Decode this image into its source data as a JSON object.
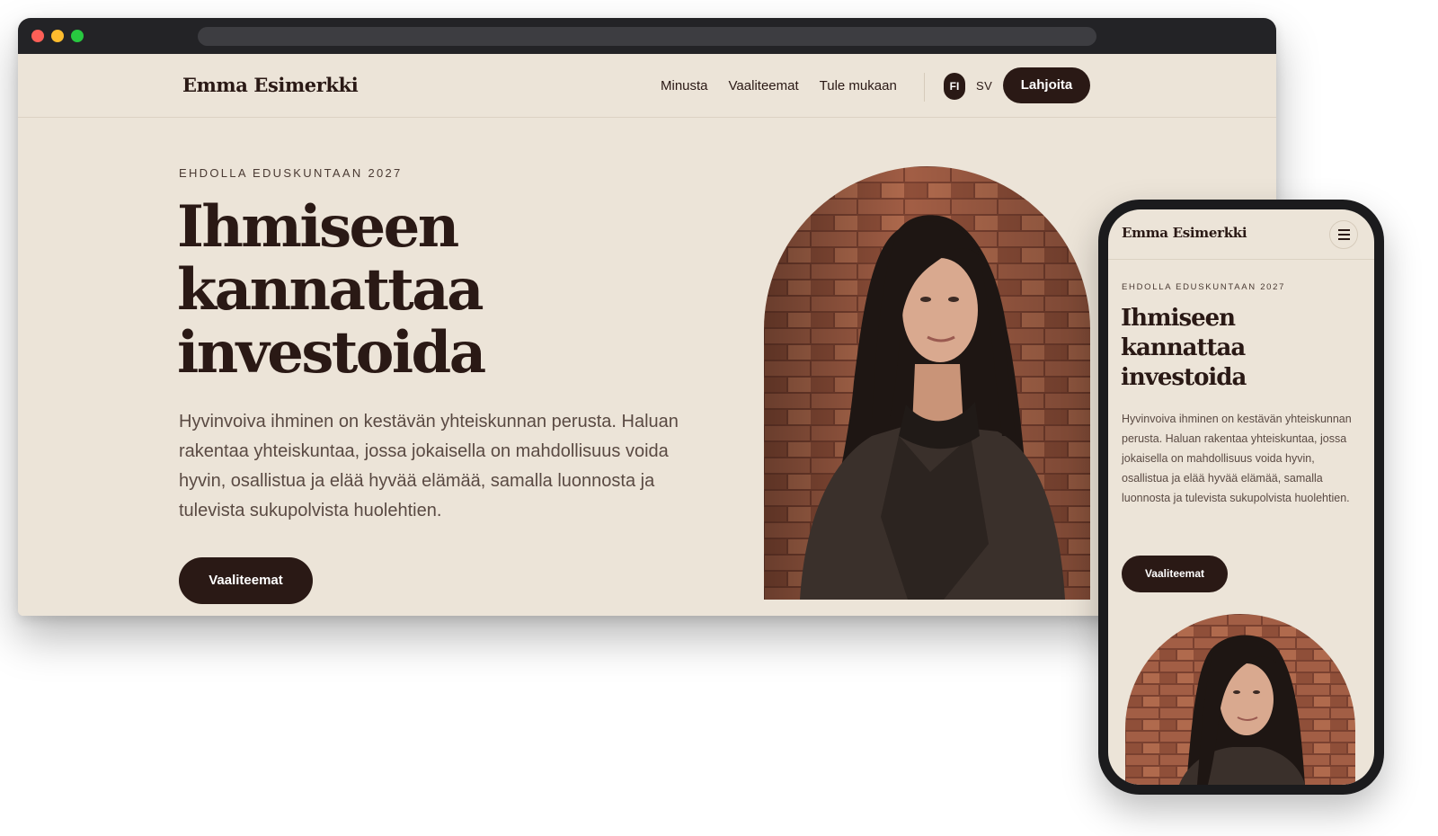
{
  "desktop": {
    "nav": {
      "brand": "Emma Esimerkki",
      "links": [
        "Minusta",
        "Vaaliteemat",
        "Tule mukaan"
      ],
      "languages": [
        "FI",
        "SV"
      ],
      "active_language": "FI",
      "donate_label": "Lahjoita"
    },
    "hero": {
      "eyebrow": "EHDOLLA EDUSKUNTAAN 2027",
      "headline": [
        "Ihmiseen",
        "kannattaa",
        "investoida"
      ],
      "lead": "Hyvinvoiva ihminen on kestävän yhteiskunnan perusta. Haluan rakentaa yhteiskuntaa, jossa jokaisella on mahdollisuus voida hyvin, osallistua ja elää hyvää elämää, samalla luonnosta ja tulevista sukupolvista huolehtien.",
      "cta_label": "Vaaliteemat"
    }
  },
  "mobile": {
    "brand": "Emma Esimerkki",
    "menu_icon": "hamburger-icon",
    "eyebrow": "EHDOLLA EDUSKUNTAAN 2027",
    "headline": [
      "Ihmiseen",
      "kannattaa",
      "investoida"
    ],
    "lead": "Hyvinvoiva ihminen on kestävän yhteiskunnan perusta. Haluan rakentaa yhteiskuntaa, jossa jokaisella on mahdollisuus voida hyvin, osallistua ja elää hyvää elämää, samalla luonnosta ja tulevista sukupolvista huolehtien.",
    "cta_label": "Vaaliteemat"
  },
  "colors": {
    "background": "#ece4d8",
    "primary": "#2a1915",
    "body_text": "#5a4a43",
    "brick": "#9a5a43",
    "hair": "#1e1613",
    "coat": "#3a302b",
    "skin": "#d9a98f"
  }
}
